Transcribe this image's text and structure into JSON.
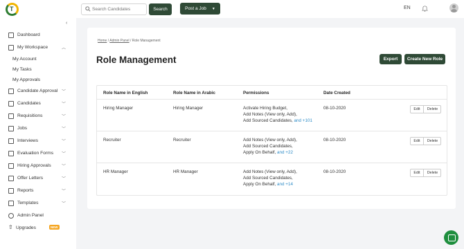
{
  "header": {
    "search_placeholder": "Search Candidates",
    "search_button": "Search",
    "post_job_button": "Post a Job",
    "language": "EN"
  },
  "sidebar": {
    "items": [
      {
        "label": "Dashboard",
        "icon": "dashboard-icon"
      },
      {
        "label": "My Workspace",
        "icon": "laptop-icon",
        "expanded": true,
        "children": [
          "My Account",
          "My Tasks",
          "My Approvals"
        ]
      },
      {
        "label": "Candidate Approval",
        "icon": "shuffle-icon"
      },
      {
        "label": "Candidates",
        "icon": "people-icon"
      },
      {
        "label": "Requisitions",
        "icon": "refresh-icon"
      },
      {
        "label": "Jobs",
        "icon": "briefcase-icon"
      },
      {
        "label": "Interviews",
        "icon": "calendar-icon"
      },
      {
        "label": "Evaluation Forms",
        "icon": "clipboard-icon"
      },
      {
        "label": "Hiring Approvals",
        "icon": "user-check-icon"
      },
      {
        "label": "Offer Letters",
        "icon": "document-icon"
      },
      {
        "label": "Reports",
        "icon": "chart-icon"
      },
      {
        "label": "Templates",
        "icon": "mail-icon"
      },
      {
        "label": "Admin Panel",
        "icon": "gear-icon"
      },
      {
        "label": "Upgrades",
        "icon": "arrow-up-icon",
        "badge": "NEW"
      }
    ]
  },
  "breadcrumb": {
    "home": "Home",
    "admin": "Admin Panel",
    "current": "Role Management",
    "sep": " / "
  },
  "page": {
    "title": "Role Management",
    "export_button": "Export",
    "create_button": "Create New Role"
  },
  "table": {
    "headers": [
      "Role Name in English",
      "Role Name in Arabic",
      "Permissions",
      "Date Created"
    ],
    "rows": [
      {
        "english": "Hiring Manager",
        "arabic": "Hiring Manager",
        "permissions": [
          "Activate Hiring Budget,",
          "Add Notes (View only, Add),",
          "Add Sourced Candidates,"
        ],
        "more": "and +101",
        "date": "08-10-2020"
      },
      {
        "english": "Recruiter",
        "arabic": "Recruiter",
        "permissions": [
          "Add Notes (View only, Add),",
          "Add Sourced Candidates,",
          "Apply On Behalf,"
        ],
        "more": "and +22",
        "date": "08-10-2020"
      },
      {
        "english": "HR Manager",
        "arabic": "HR Manager",
        "permissions": [
          "Add Notes (View only, Add),",
          "Add Sourced Candidates,",
          "Apply On Behalf,"
        ],
        "more": "and +14",
        "date": "08-10-2020"
      }
    ],
    "edit_label": "Edit",
    "delete_label": "Delete"
  },
  "colors": {
    "primary": "#2f4a36",
    "link": "#2b8ac6",
    "chat": "#1e8e3e",
    "badge": "#f5a623"
  }
}
